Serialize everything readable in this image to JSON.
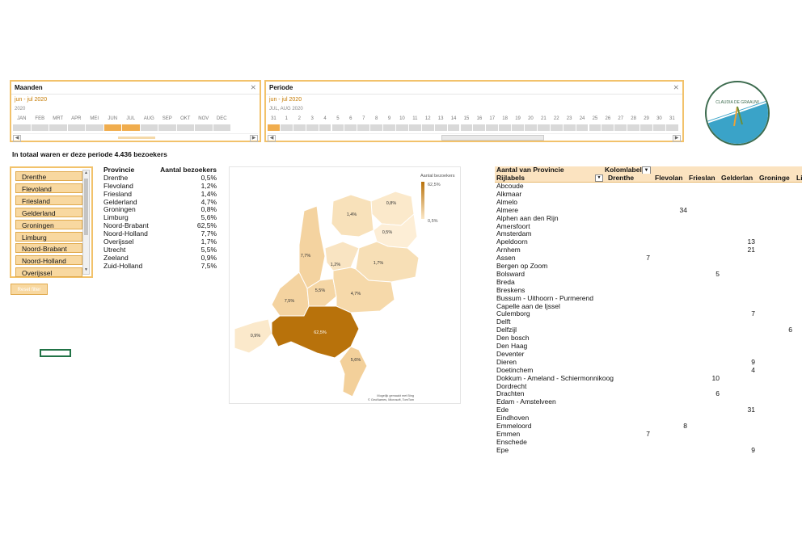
{
  "timeline_maanden": {
    "title": "Maanden",
    "range_text": "jun - jul 2020",
    "year": "2020",
    "months": [
      "JAN",
      "FEB",
      "MRT",
      "APR",
      "MEI",
      "JUN",
      "JUL",
      "AUG",
      "SEP",
      "OKT",
      "NOV",
      "DEC"
    ],
    "selected": [
      5,
      6
    ]
  },
  "timeline_periode": {
    "title": "Periode",
    "range_text": "jun - jul 2020",
    "sub": "JUL, AUG 2020",
    "days": [
      "31",
      "1",
      "2",
      "3",
      "4",
      "5",
      "6",
      "7",
      "8",
      "9",
      "10",
      "11",
      "12",
      "13",
      "14",
      "15",
      "16",
      "17",
      "18",
      "19",
      "20",
      "21",
      "22",
      "23",
      "24",
      "25",
      "26",
      "27",
      "28",
      "29",
      "30",
      "31"
    ],
    "selected": [
      0
    ]
  },
  "logo": {
    "text": "CLAUDIA DE GRAAUW"
  },
  "total_text": "In totaal waren er deze periode 4.436 bezoekers",
  "slicer_items": [
    "Drenthe",
    "Flevoland",
    "Friesland",
    "Gelderland",
    "Groningen",
    "Limburg",
    "Noord-Brabant",
    "Noord-Holland",
    "Overijssel"
  ],
  "reset_label": "Reset filter",
  "province_table": {
    "header": [
      "Provincie",
      "Aantal bezoekers"
    ],
    "rows": [
      [
        "Drenthe",
        "0,5%"
      ],
      [
        "Flevoland",
        "1,2%"
      ],
      [
        "Friesland",
        "1,4%"
      ],
      [
        "Gelderland",
        "4,7%"
      ],
      [
        "Groningen",
        "0,8%"
      ],
      [
        "Limburg",
        "5,6%"
      ],
      [
        "Noord-Brabant",
        "62,5%"
      ],
      [
        "Noord-Holland",
        "7,7%"
      ],
      [
        "Overijssel",
        "1,7%"
      ],
      [
        "Utrecht",
        "5,5%"
      ],
      [
        "Zeeland",
        "0,9%"
      ],
      [
        "Zuid-Holland",
        "7,5%"
      ]
    ]
  },
  "map": {
    "legend_title": "Aantal bezoekers",
    "legend_max": "62,5%",
    "legend_min": "0,5%",
    "credit1": "Mogelijk gemaakt met Bing",
    "credit2": "© GeoNames, Microsoft, TomTom",
    "labels": {
      "groningen": "0,8%",
      "friesland": "1,4%",
      "drenthe": "0,5%",
      "noord_holland": "7,7%",
      "flevoland": "1,2%",
      "overijssel": "1,7%",
      "zuid_holland": "7,5%",
      "utrecht": "5,5%",
      "gelderland": "4,7%",
      "zeeland": "0,9%",
      "noord_brabant": "62,5%",
      "limburg": "5,6%"
    },
    "colors": {
      "low": "#fbe7c6",
      "mid": "#f5d7a6",
      "high": "#b8720b"
    }
  },
  "pivot": {
    "header1": "Aantal van Provincie",
    "header1b": "Kolomlabels",
    "row_label": "Rijlabels",
    "columns": [
      "Drenthe",
      "Flevolan",
      "Frieslan",
      "Gelderlan",
      "Groninge",
      "Li"
    ],
    "rows": [
      {
        "name": "Abcoude",
        "vals": [
          "",
          "",
          "",
          "",
          "",
          ""
        ]
      },
      {
        "name": "Alkmaar",
        "vals": [
          "",
          "",
          "",
          "",
          "",
          ""
        ]
      },
      {
        "name": "Almelo",
        "vals": [
          "",
          "",
          "",
          "",
          "",
          ""
        ]
      },
      {
        "name": "Almere",
        "vals": [
          "",
          "34",
          "",
          "",
          "",
          ""
        ]
      },
      {
        "name": "Alphen aan den Rijn",
        "vals": [
          "",
          "",
          "",
          "",
          "",
          ""
        ]
      },
      {
        "name": "Amersfoort",
        "vals": [
          "",
          "",
          "",
          "",
          "",
          ""
        ]
      },
      {
        "name": "Amsterdam",
        "vals": [
          "",
          "",
          "",
          "",
          "",
          ""
        ]
      },
      {
        "name": "Apeldoorn",
        "vals": [
          "",
          "",
          "",
          "13",
          "",
          ""
        ]
      },
      {
        "name": "Arnhem",
        "vals": [
          "",
          "",
          "",
          "21",
          "",
          ""
        ]
      },
      {
        "name": "Assen",
        "vals": [
          "7",
          "",
          "",
          "",
          "",
          ""
        ]
      },
      {
        "name": "Bergen op Zoom",
        "vals": [
          "",
          "",
          "",
          "",
          "",
          ""
        ]
      },
      {
        "name": "Bolsward",
        "vals": [
          "",
          "",
          "5",
          "",
          "",
          ""
        ]
      },
      {
        "name": "Breda",
        "vals": [
          "",
          "",
          "",
          "",
          "",
          ""
        ]
      },
      {
        "name": "Breskens",
        "vals": [
          "",
          "",
          "",
          "",
          "",
          ""
        ]
      },
      {
        "name": "Bussum - Uithoorn - Purmerend",
        "vals": [
          "",
          "",
          "",
          "",
          "",
          ""
        ]
      },
      {
        "name": "Capelle aan de Ijssel",
        "vals": [
          "",
          "",
          "",
          "",
          "",
          ""
        ]
      },
      {
        "name": "Culemborg",
        "vals": [
          "",
          "",
          "",
          "7",
          "",
          ""
        ]
      },
      {
        "name": "Delft",
        "vals": [
          "",
          "",
          "",
          "",
          "",
          ""
        ]
      },
      {
        "name": "Delfzijl",
        "vals": [
          "",
          "",
          "",
          "",
          "6",
          ""
        ]
      },
      {
        "name": "Den bosch",
        "vals": [
          "",
          "",
          "",
          "",
          "",
          ""
        ]
      },
      {
        "name": "Den Haag",
        "vals": [
          "",
          "",
          "",
          "",
          "",
          ""
        ]
      },
      {
        "name": "Deventer",
        "vals": [
          "",
          "",
          "",
          "",
          "",
          ""
        ]
      },
      {
        "name": "Dieren",
        "vals": [
          "",
          "",
          "",
          "9",
          "",
          ""
        ]
      },
      {
        "name": "Doetinchem",
        "vals": [
          "",
          "",
          "",
          "4",
          "",
          ""
        ]
      },
      {
        "name": "Dokkum - Ameland - Schiermonnikoog",
        "vals": [
          "",
          "",
          "10",
          "",
          "",
          ""
        ]
      },
      {
        "name": "Dordrecht",
        "vals": [
          "",
          "",
          "",
          "",
          "",
          ""
        ]
      },
      {
        "name": "Drachten",
        "vals": [
          "",
          "",
          "6",
          "",
          "",
          ""
        ]
      },
      {
        "name": "Edam - Amstelveen",
        "vals": [
          "",
          "",
          "",
          "",
          "",
          ""
        ]
      },
      {
        "name": "Ede",
        "vals": [
          "",
          "",
          "",
          "31",
          "",
          ""
        ]
      },
      {
        "name": "Eindhoven",
        "vals": [
          "",
          "",
          "",
          "",
          "",
          ""
        ]
      },
      {
        "name": "Emmeloord",
        "vals": [
          "",
          "8",
          "",
          "",
          "",
          ""
        ]
      },
      {
        "name": "Emmen",
        "vals": [
          "7",
          "",
          "",
          "",
          "",
          ""
        ]
      },
      {
        "name": "Enschede",
        "vals": [
          "",
          "",
          "",
          "",
          "",
          ""
        ]
      },
      {
        "name": "Epe",
        "vals": [
          "",
          "",
          "",
          "9",
          "",
          ""
        ]
      }
    ]
  }
}
